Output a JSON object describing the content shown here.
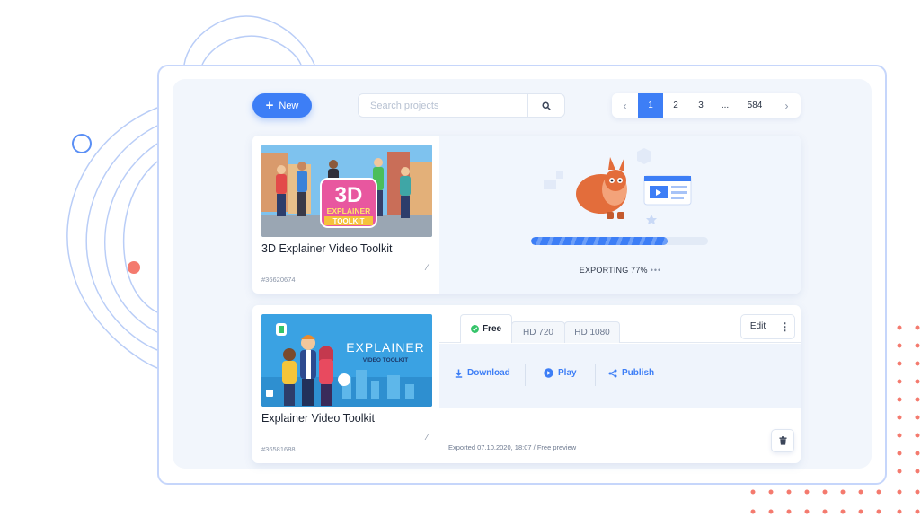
{
  "toolbar": {
    "new_label": "New",
    "search_placeholder": "Search projects"
  },
  "pagination": {
    "pages": [
      "1",
      "2",
      "3",
      "...",
      "584"
    ],
    "current": "1"
  },
  "projects": [
    {
      "title": "3D Explainer Video Toolkit",
      "id": "#36620674",
      "thumbnail_text": [
        "3D",
        "EXPLAINER",
        "TOOLKIT"
      ],
      "export_status": "EXPORTING 77%",
      "export_progress": 0.77
    },
    {
      "title": "Explainer Video Toolkit",
      "id": "#36581688",
      "thumbnail_text": [
        "EXPLAINER",
        "VIDEO TOOLKIT"
      ],
      "tabs": [
        "Free",
        "HD 720",
        "HD 1080"
      ],
      "active_tab": "Free",
      "edit_label": "Edit",
      "actions": [
        "Download",
        "Play",
        "Publish"
      ],
      "exported_info": "Exported 07.10.2020, 18:07 / Free preview"
    }
  ],
  "colors": {
    "accent": "#3d7ef6",
    "success": "#35c46a",
    "decor_red": "#f47a6e"
  },
  "icons": [
    "plus-icon",
    "search-icon",
    "chevron-left-icon",
    "chevron-right-icon",
    "pencil-icon",
    "check-icon",
    "download-icon",
    "play-icon",
    "share-icon",
    "more-vertical-icon",
    "trash-icon"
  ]
}
